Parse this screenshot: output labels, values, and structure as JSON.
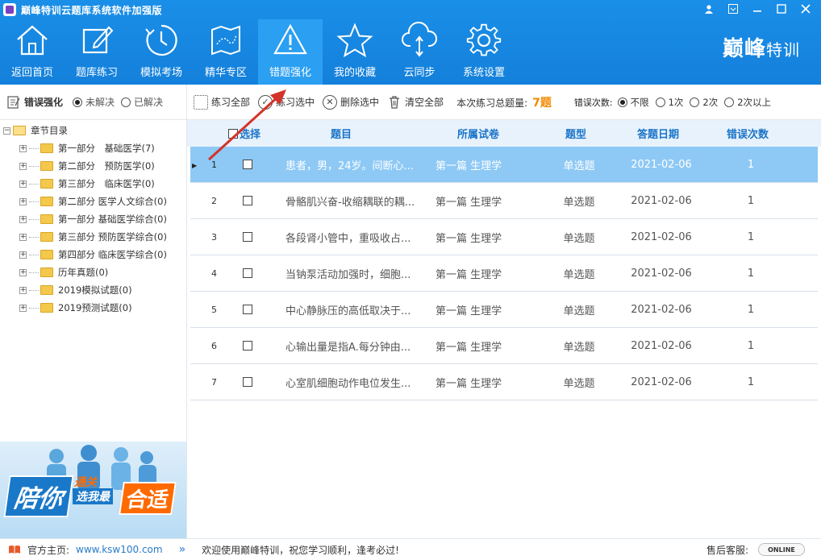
{
  "app": {
    "title": "巅峰特训云题库系统软件加强版",
    "brand_main": "巅峰",
    "brand_sub": "特训"
  },
  "window_controls": [
    "user-icon",
    "menu-icon",
    "minimize-icon",
    "maximize-icon",
    "close-icon"
  ],
  "nav": [
    {
      "label": "返回首页",
      "icon": "home-icon"
    },
    {
      "label": "题库练习",
      "icon": "edit-icon"
    },
    {
      "label": "模拟考场",
      "icon": "timer-icon"
    },
    {
      "label": "精华专区",
      "icon": "map-icon"
    },
    {
      "label": "错题强化",
      "icon": "warning-icon",
      "active": true
    },
    {
      "label": "我的收藏",
      "icon": "star-icon"
    },
    {
      "label": "云同步",
      "icon": "cloud-sync-icon"
    },
    {
      "label": "系统设置",
      "icon": "gear-icon"
    }
  ],
  "left": {
    "title": "错误强化",
    "filter_unsolved": "未解决",
    "filter_solved": "已解决",
    "tree_root": "章节目录",
    "tree_items": [
      "第一部分　基础医学(7)",
      "第二部分　预防医学(0)",
      "第三部分　临床医学(0)",
      "第二部分 医学人文综合(0)",
      "第一部分 基础医学综合(0)",
      "第三部分 预防医学综合(0)",
      "第四部分 临床医学综合(0)",
      "历年真题(0)",
      "2019模拟试题(0)",
      "2019预测试题(0)"
    ],
    "banner": {
      "big": "陪你",
      "line1": "通关",
      "line2": "选我最",
      "accent": "合适"
    }
  },
  "toolbar": {
    "practice_all": "练习全部",
    "practice_selected": "练习选中",
    "delete_selected": "删除选中",
    "clear_all": "清空全部",
    "total_label": "本次练习总题量:",
    "total_value": "7题",
    "error_count_label": "错误次数:",
    "error_options": [
      "不限",
      "1次",
      "2次",
      "2次以上"
    ]
  },
  "table": {
    "headers": {
      "select": "选择",
      "question": "题目",
      "paper": "所属试卷",
      "type": "题型",
      "date": "答题日期",
      "errors": "错误次数"
    },
    "rows": [
      {
        "no": "1",
        "question": "患者，男，24岁。间断心...",
        "paper": "第一篇 生理学",
        "type": "单选题",
        "date": "2021-02-06",
        "errors": "1"
      },
      {
        "no": "2",
        "question": "骨骼肌兴奋-收缩耦联的耦...",
        "paper": "第一篇 生理学",
        "type": "单选题",
        "date": "2021-02-06",
        "errors": "1"
      },
      {
        "no": "3",
        "question": "各段肾小管中，重吸收占...",
        "paper": "第一篇 生理学",
        "type": "单选题",
        "date": "2021-02-06",
        "errors": "1"
      },
      {
        "no": "4",
        "question": "当钠泵活动加强时，细胞...",
        "paper": "第一篇 生理学",
        "type": "单选题",
        "date": "2021-02-06",
        "errors": "1"
      },
      {
        "no": "5",
        "question": "中心静脉压的高低取决于...",
        "paper": "第一篇 生理学",
        "type": "单选题",
        "date": "2021-02-06",
        "errors": "1"
      },
      {
        "no": "6",
        "question": "心输出量是指A.每分钟由...",
        "paper": "第一篇 生理学",
        "type": "单选题",
        "date": "2021-02-06",
        "errors": "1"
      },
      {
        "no": "7",
        "question": "心室肌细胞动作电位发生...",
        "paper": "第一篇 生理学",
        "type": "单选题",
        "date": "2021-02-06",
        "errors": "1"
      }
    ]
  },
  "status": {
    "home_label": "官方主页:",
    "home_url": "www.ksw100.com",
    "welcome": "欢迎使用巅峰特训，祝您学习顺利，逢考必过!",
    "service_label": "售后客服:",
    "online": "ONLINE"
  },
  "colors": {
    "primary": "#1a8fe8",
    "selected_row": "#8ec9f5",
    "accent": "#f28a00",
    "header_text": "#1a74c8"
  }
}
